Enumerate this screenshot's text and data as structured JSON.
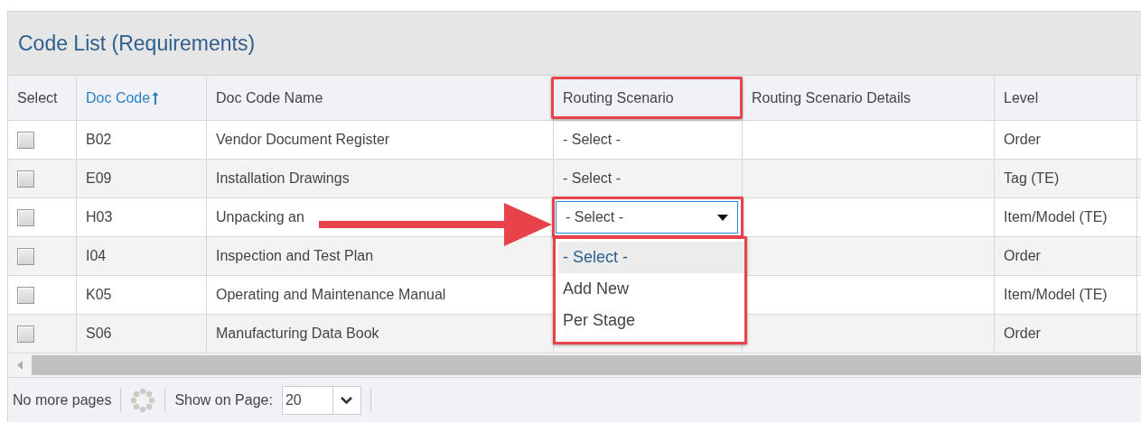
{
  "title": "Code List (Requirements)",
  "columns": [
    {
      "label": "Select",
      "sorted": false
    },
    {
      "label": "Doc Code",
      "sorted": true
    },
    {
      "label": "Doc Code Name",
      "sorted": false
    },
    {
      "label": "Routing Scenario",
      "sorted": false
    },
    {
      "label": "Routing Scenario Details",
      "sorted": false
    },
    {
      "label": "Level",
      "sorted": false
    }
  ],
  "rows": [
    {
      "checked": false,
      "doc_code": "B02",
      "name": "Vendor Document Register",
      "routing": {
        "kind": "text",
        "value": "- Select -"
      },
      "level": "Order"
    },
    {
      "checked": false,
      "doc_code": "E09",
      "name": "Installation Drawings",
      "routing": {
        "kind": "text",
        "value": "- Select -"
      },
      "level": "Tag (TE)"
    },
    {
      "checked": false,
      "doc_code": "H03",
      "name": "Unpacking an",
      "routing": {
        "kind": "select",
        "value": "- Select -",
        "expanded": true
      },
      "level": "Item/Model (TE)"
    },
    {
      "checked": false,
      "doc_code": "I04",
      "name": "Inspection and Test Plan",
      "level": "Order"
    },
    {
      "checked": false,
      "doc_code": "K05",
      "name": "Operating and Maintenance Manual",
      "level": "Item/Model (TE)"
    },
    {
      "checked": false,
      "doc_code": "S06",
      "name": "Manufacturing Data Book",
      "level": "Order"
    }
  ],
  "dropdown_options": [
    {
      "label": "- Select -",
      "selected": true
    },
    {
      "label": "Add New",
      "selected": false
    },
    {
      "label": "Per Stage",
      "selected": false
    }
  ],
  "footer": {
    "paging": "No more pages",
    "show_label": "Show on Page:",
    "page_size": "20"
  }
}
